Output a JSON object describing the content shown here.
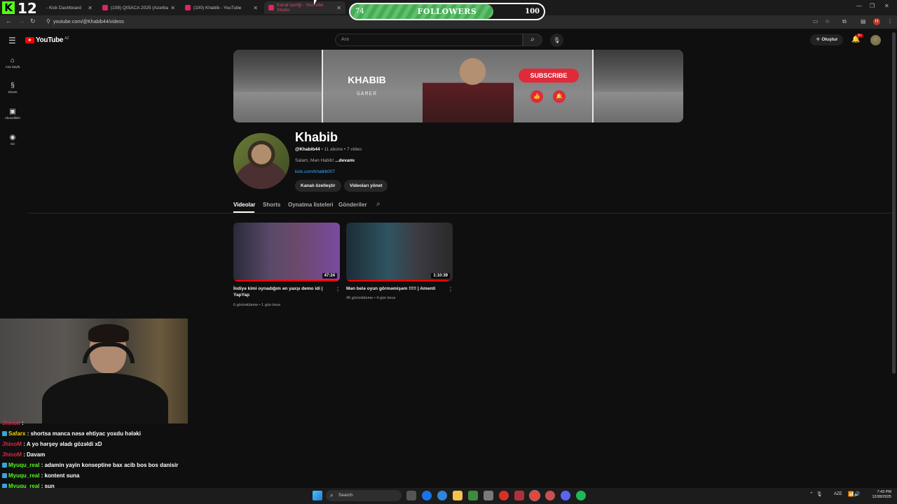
{
  "overlay": {
    "streamer_number": "12",
    "followers_current": "74",
    "followers_label": "FOLLOWERS",
    "followers_goal": "100",
    "followers_progress": 0.74,
    "accent": "#53fc18"
  },
  "browser": {
    "tabs": [
      {
        "label": "- Kick Dashboard",
        "active": false
      },
      {
        "label": "(108) QISACA 2025 (Azərbaycan",
        "active": false
      },
      {
        "label": "(100) Khabib - YouTube",
        "active": false
      },
      {
        "label": "Kanal içeriği - YouTube Studio",
        "active": true
      }
    ],
    "url": "youtube.com/@Khabib44/videos"
  },
  "youtube": {
    "logo": "YouTube",
    "region": "AZ",
    "search_placeholder": "Ara",
    "create_label": "Oluştur",
    "notif_badge": "9+",
    "sidebar": [
      {
        "icon": "home-icon",
        "label": "Ana Sayfa"
      },
      {
        "icon": "shorts-icon",
        "label": "Shorts"
      },
      {
        "icon": "subscriptions-icon",
        "label": "Abonelikler"
      },
      {
        "icon": "you-icon",
        "label": "Siz"
      }
    ]
  },
  "banner": {
    "name": "KHABIB",
    "subtitle": "GAMER",
    "subscribe_label": "SUBSCRIBE"
  },
  "channel": {
    "name": "Khabib",
    "handle": "@Khabib44",
    "stats": " • 11 abone • 7 video",
    "description": "Salam, Mən Habib!",
    "more": "...devamı",
    "link": "kick.com/khabib007",
    "customize_label": "Kanalı özelleştir",
    "manage_label": "Videoları yönet"
  },
  "tabs": [
    "Videolar",
    "Shorts",
    "Oynatma listeleri",
    "Gönderiler"
  ],
  "videos": [
    {
      "title": "İndiyə kimi oynadığım ən yaxşı demo idi | YapYap",
      "meta": "6 görüntüleme • 1 gün önce",
      "duration": "47:24",
      "progress": 0.98
    },
    {
      "title": "Mən belə oyun görməmişəm !!!!! | Amenti",
      "meta": "45 görüntüleme • 4 gün önce",
      "duration": "1:10:39",
      "progress": 0.96
    }
  ],
  "chat": [
    {
      "user": "Jhinoll",
      "msg": "",
      "color": "#d82840",
      "badge": false
    },
    {
      "user": "Safarx",
      "msg": "shortsa manca nəsə ehtiyac yoxdu hələki",
      "color": "#f5d400",
      "badge": true
    },
    {
      "user": "JhinoM",
      "msg": "A yo hərşey əladı gözəldi xD",
      "color": "#d82840",
      "badge": false
    },
    {
      "user": "JhinoM",
      "msg": "Davam",
      "color": "#d82840",
      "badge": false
    },
    {
      "user": "Myuqu_real",
      "msg": "adamin yayin konseptine bax acib bos bos danisir",
      "color": "#53fc18",
      "badge": true
    },
    {
      "user": "Myuqu_real",
      "msg": "kontent suna",
      "color": "#53fc18",
      "badge": true
    },
    {
      "user": "Myuqu_real",
      "msg": "sun",
      "color": "#53fc18",
      "badge": true
    },
    {
      "user": "Myuqu_real",
      "msg": ":/",
      "color": "#53fc18",
      "badge": true
    }
  ],
  "taskbar": {
    "search_label": "Search",
    "lang": "AZE",
    "time": "7:43 PM",
    "date": "12/28/2025"
  }
}
